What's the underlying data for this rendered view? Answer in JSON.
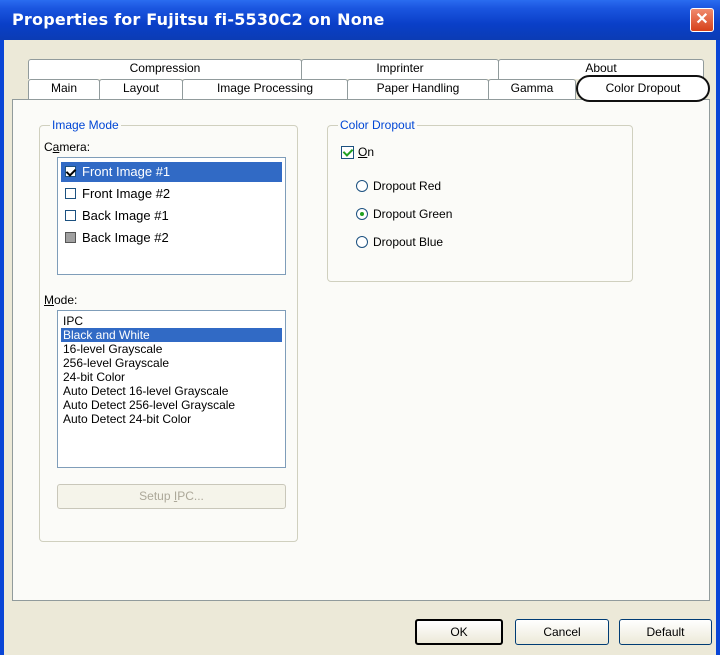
{
  "window": {
    "title": "Properties for Fujitsu fi-5530C2 on None",
    "close_label": "✕"
  },
  "tabs_row1": [
    "Compression",
    "Imprinter",
    "About"
  ],
  "tabs_row2": [
    "Main",
    "Layout",
    "Image Processing",
    "Paper Handling",
    "Gamma",
    "Color Dropout"
  ],
  "active_tab": "Color Dropout",
  "image_mode": {
    "group_label": "Image Mode",
    "camera_label_prefix": "C",
    "camera_label_underlined": "a",
    "camera_label_suffix": "mera:",
    "cameras": [
      {
        "label": "Front Image #1",
        "checked": true,
        "selected": true
      },
      {
        "label": "Front Image #2",
        "checked": false,
        "selected": false
      },
      {
        "label": "Back Image #1",
        "checked": false,
        "selected": false
      },
      {
        "label": "Back Image #2",
        "checked": false,
        "selected": false,
        "greyed": true
      }
    ],
    "mode_label_underlined": "M",
    "mode_label_suffix": "ode:",
    "modes": [
      "IPC",
      "Black and White",
      "16-level Grayscale",
      "256-level Grayscale",
      "24-bit Color",
      "Auto Detect 16-level Grayscale",
      "Auto Detect 256-level Grayscale",
      "Auto Detect 24-bit Color"
    ],
    "selected_mode": "Black and White",
    "setup_button": {
      "prefix": "Setup ",
      "underlined": "I",
      "suffix": "PC..."
    }
  },
  "color_dropout": {
    "group_label": "Color Dropout",
    "on_underlined": "O",
    "on_suffix": "n",
    "on_checked": true,
    "options": [
      "Dropout Red",
      "Dropout Green",
      "Dropout Blue"
    ],
    "selected_option": "Dropout Green"
  },
  "buttons": {
    "ok": "OK",
    "cancel": "Cancel",
    "default": "Default"
  },
  "colors": {
    "titlebar": "#0a3fc8",
    "selection": "#316ac5",
    "group_label": "#0046d5"
  }
}
